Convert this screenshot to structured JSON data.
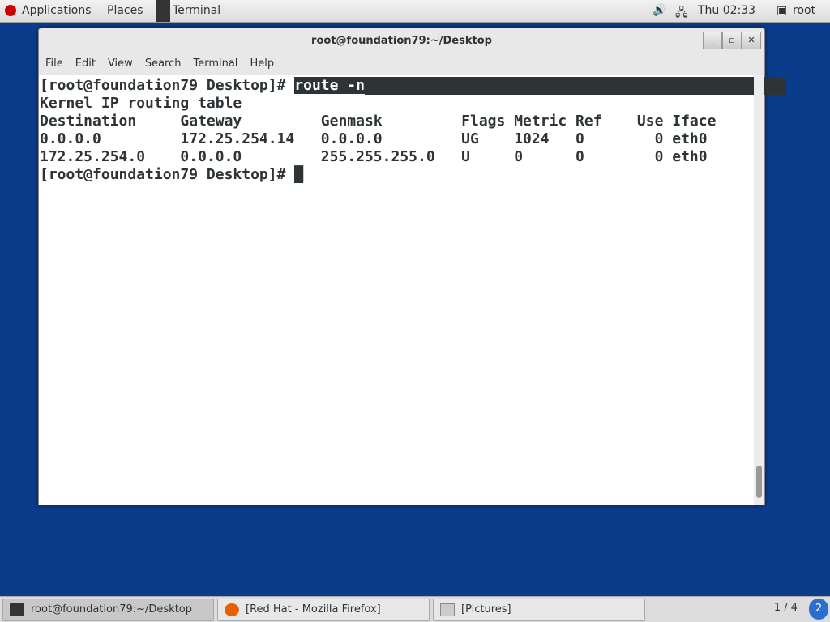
{
  "topbar": {
    "applications": "Applications",
    "places": "Places",
    "active_app": "Terminal",
    "clock": "Thu 02:33",
    "user": "root"
  },
  "window": {
    "title": "root@foundation79:~/Desktop",
    "menu": [
      "File",
      "Edit",
      "View",
      "Search",
      "Terminal",
      "Help"
    ]
  },
  "terminal": {
    "prompt": "[root@foundation79 Desktop]# ",
    "command": "route -n",
    "lines": [
      "Kernel IP routing table",
      "Destination     Gateway         Genmask         Flags Metric Ref    Use Iface",
      "0.0.0.0         172.25.254.14   0.0.0.0         UG    1024   0        0 eth0",
      "172.25.254.0    0.0.0.0         255.255.255.0   U     0      0        0 eth0"
    ]
  },
  "taskbar": {
    "items": [
      "root@foundation79:~/Desktop",
      "[Red Hat - Mozilla Firefox]",
      "[Pictures]"
    ],
    "pager": "1 / 4",
    "workspace": "2"
  },
  "colors": {
    "desktop": "#0b3c8c",
    "terminal_bg": "#ffffff",
    "terminal_fg": "#2e3436"
  }
}
